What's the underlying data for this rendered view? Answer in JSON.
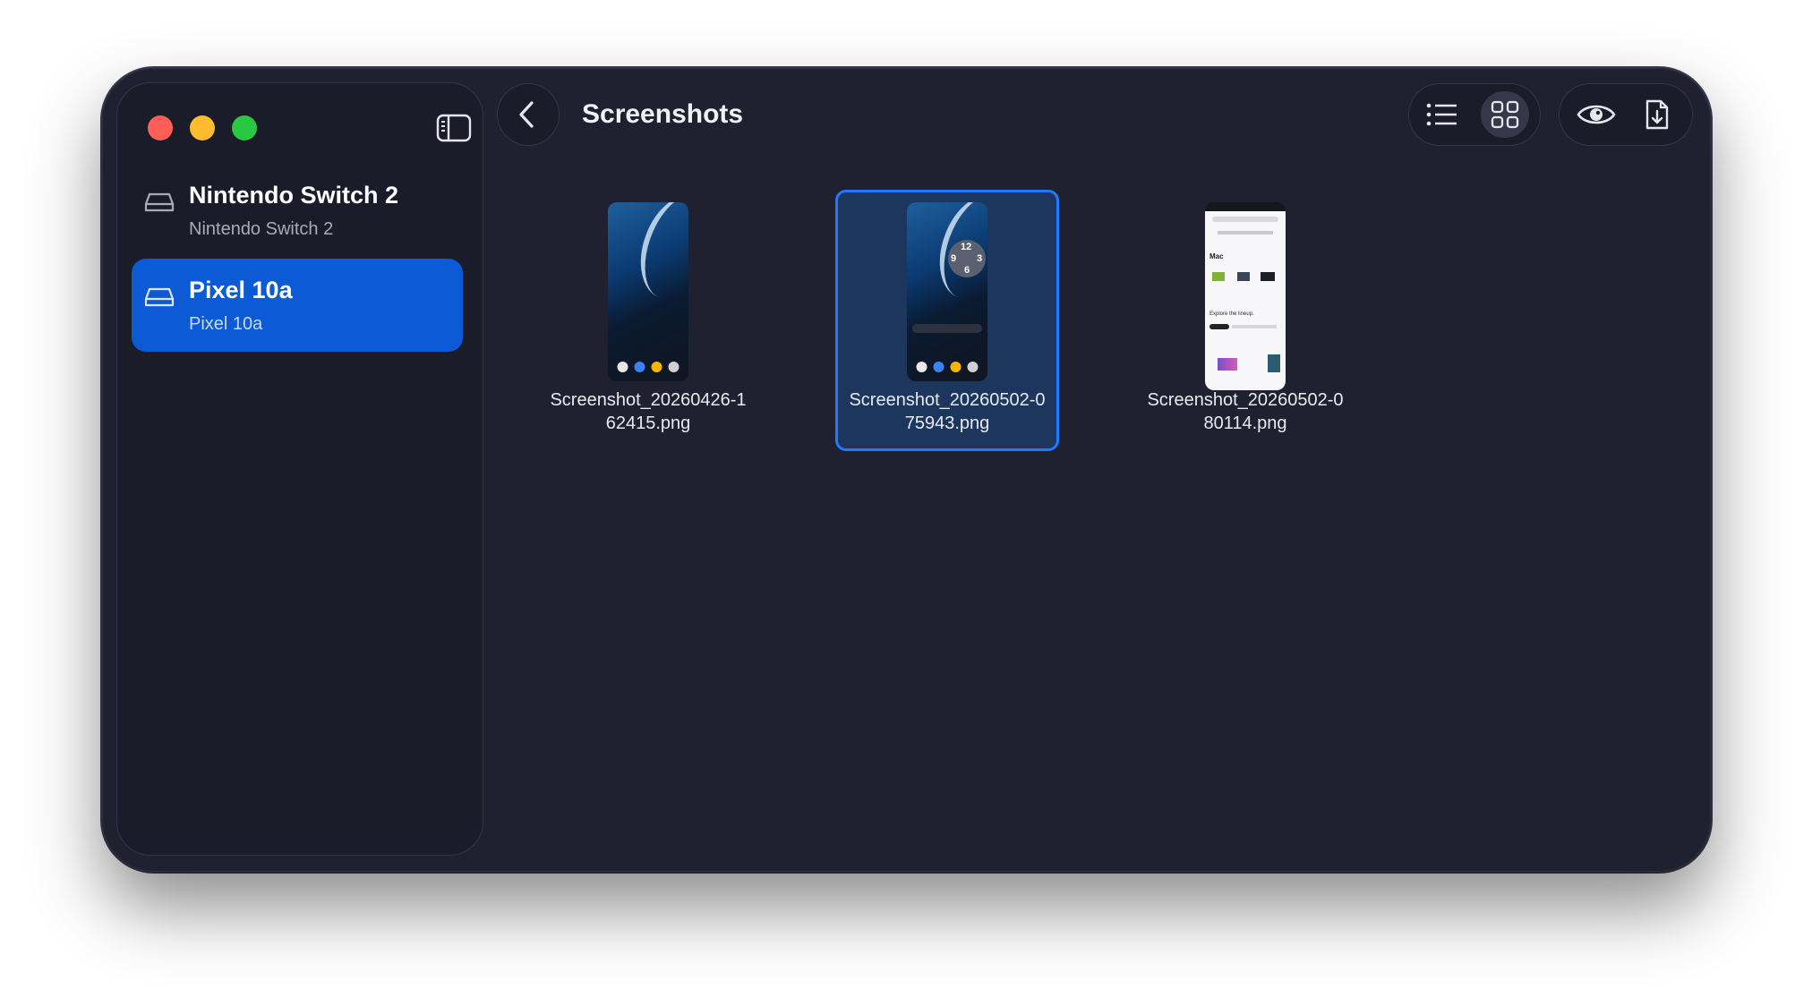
{
  "window": {
    "traffic_lights": [
      "close",
      "minimize",
      "zoom"
    ],
    "sidebar_toggle_icon": "sidebar-icon"
  },
  "sidebar": {
    "devices": [
      {
        "name": "Nintendo Switch 2",
        "subtitle": "Nintendo Switch 2",
        "icon": "drive-icon",
        "selected": false
      },
      {
        "name": "Pixel 10a",
        "subtitle": "Pixel 10a",
        "icon": "drive-icon",
        "selected": true
      }
    ]
  },
  "toolbar": {
    "title": "Screenshots",
    "back_icon": "chevron-left-icon",
    "view_modes": [
      {
        "icon": "list-icon",
        "active": false
      },
      {
        "icon": "grid-icon",
        "active": true
      }
    ],
    "actions": [
      {
        "icon": "eye-icon"
      },
      {
        "icon": "download-file-icon"
      }
    ]
  },
  "files": [
    {
      "name": "Screenshot_20260426-162415.png",
      "selected": false
    },
    {
      "name": "Screenshot_20260502-075943.png",
      "selected": true
    },
    {
      "name": "Screenshot_20260502-080114.png",
      "selected": false
    }
  ],
  "thumbnails": {
    "clock_digits": [
      "12",
      "9",
      "3",
      "6"
    ],
    "page2_heading": "Mac",
    "page2_subheading": "Explore the lineup."
  },
  "colors": {
    "accent": "#0c5ad6",
    "selection_border": "#1f7aff",
    "window_bg": "#1f2030",
    "sidebar_bg": "#1b1c29"
  }
}
